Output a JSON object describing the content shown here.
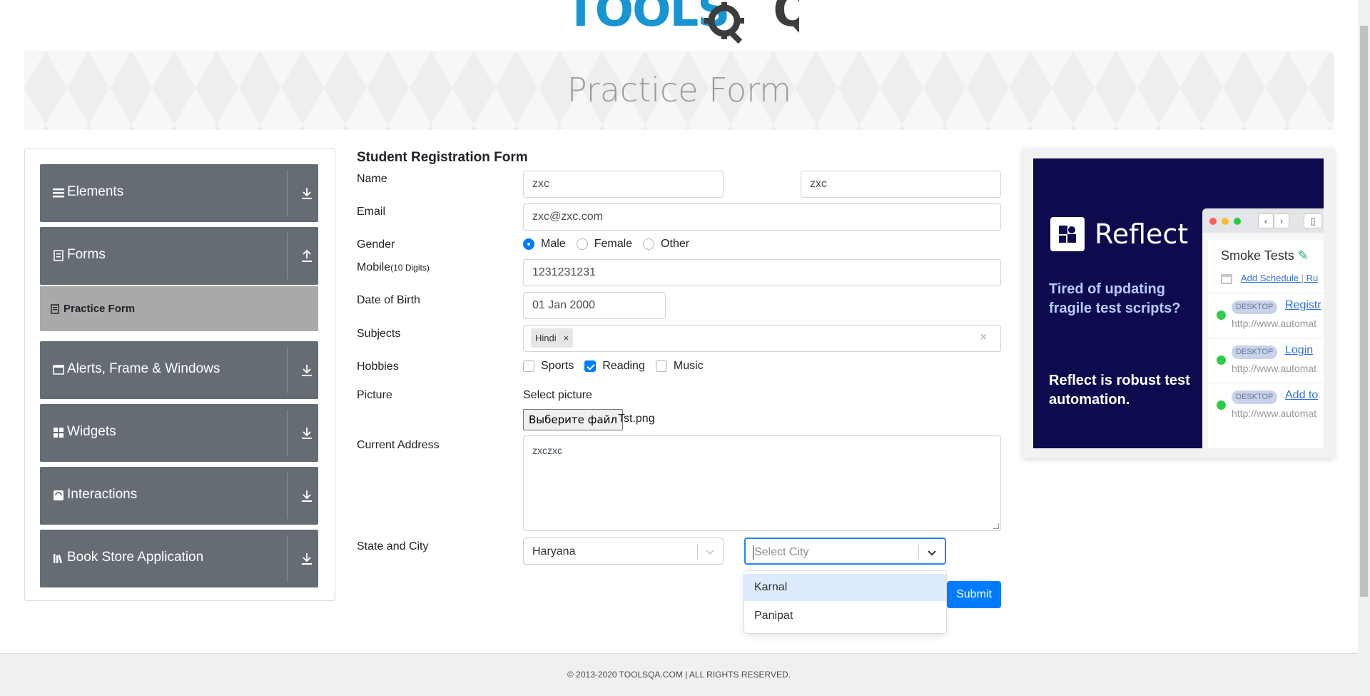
{
  "logo": {
    "part1": "TOOLS",
    "part2": "QA"
  },
  "banner": {
    "title": "Practice Form"
  },
  "sidebar": {
    "groups": [
      {
        "label": "Elements",
        "icon": "list-icon",
        "arrow": "download-icon"
      },
      {
        "label": "Forms",
        "icon": "form-icon",
        "arrow": "upload-icon"
      },
      {
        "label": "Alerts, Frame & Windows",
        "icon": "window-icon",
        "arrow": "download-icon"
      },
      {
        "label": "Widgets",
        "icon": "widgets-icon",
        "arrow": "download-icon"
      },
      {
        "label": "Interactions",
        "icon": "interactions-icon",
        "arrow": "download-icon"
      },
      {
        "label": "Book Store Application",
        "icon": "books-icon",
        "arrow": "download-icon"
      }
    ],
    "active_item": {
      "label": "Practice Form",
      "icon": "document-icon"
    }
  },
  "form": {
    "title": "Student Registration Form",
    "labels": {
      "name": "Name",
      "email": "Email",
      "gender": "Gender",
      "mobile": "Mobile",
      "mobile_hint": "(10 Digits)",
      "dob": "Date of Birth",
      "subjects": "Subjects",
      "hobbies": "Hobbies",
      "picture": "Picture",
      "address": "Current Address",
      "state_city": "State and City"
    },
    "first_name": "zxc",
    "last_name": "zxc",
    "email": "zxc@zxc.com",
    "gender_options": [
      "Male",
      "Female",
      "Other"
    ],
    "gender_selected": "Male",
    "mobile": "1231231231",
    "dob": "01 Jan 2000",
    "subjects": [
      "Hindi"
    ],
    "subject_remove": "×",
    "subjects_clear": "×",
    "hobbies": [
      {
        "label": "Sports",
        "checked": false
      },
      {
        "label": "Reading",
        "checked": true
      },
      {
        "label": "Music",
        "checked": false
      }
    ],
    "picture_label": "Select picture",
    "file_button": "Выберите файл",
    "file_name": "Tst.png",
    "address": "zxczxc",
    "state": "Haryana",
    "city_placeholder": "Select City",
    "city_options": [
      "Karnal",
      "Panipat"
    ],
    "city_highlighted": "Karnal",
    "submit": "Submit"
  },
  "ad": {
    "brand": "Reflect",
    "text1": "Tired of updating fragile test scripts?",
    "text2": "Reflect is robust test automation.",
    "panel_title": "Smoke Tests",
    "schedule_link": "Add Schedule",
    "separator": "|",
    "run_link": "Ru",
    "rows": [
      {
        "tag": "DESKTOP",
        "link": "Registr",
        "url": "http://www.automat"
      },
      {
        "tag": "DESKTOP",
        "link": "Login",
        "url": "http://www.automat"
      },
      {
        "tag": "DESKTOP",
        "link": "Add to",
        "url": "http://www.automat"
      }
    ]
  },
  "footer": {
    "text": "© 2013-2020 TOOLSQA.COM | ALL RIGHTS RESERVED."
  },
  "colors": {
    "accent": "#007bff",
    "sidebar_group": "#666c74",
    "sidebar_active": "#a9a9a9",
    "ad_background": "#0d0b4d",
    "logo_blue": "#1795d3"
  }
}
